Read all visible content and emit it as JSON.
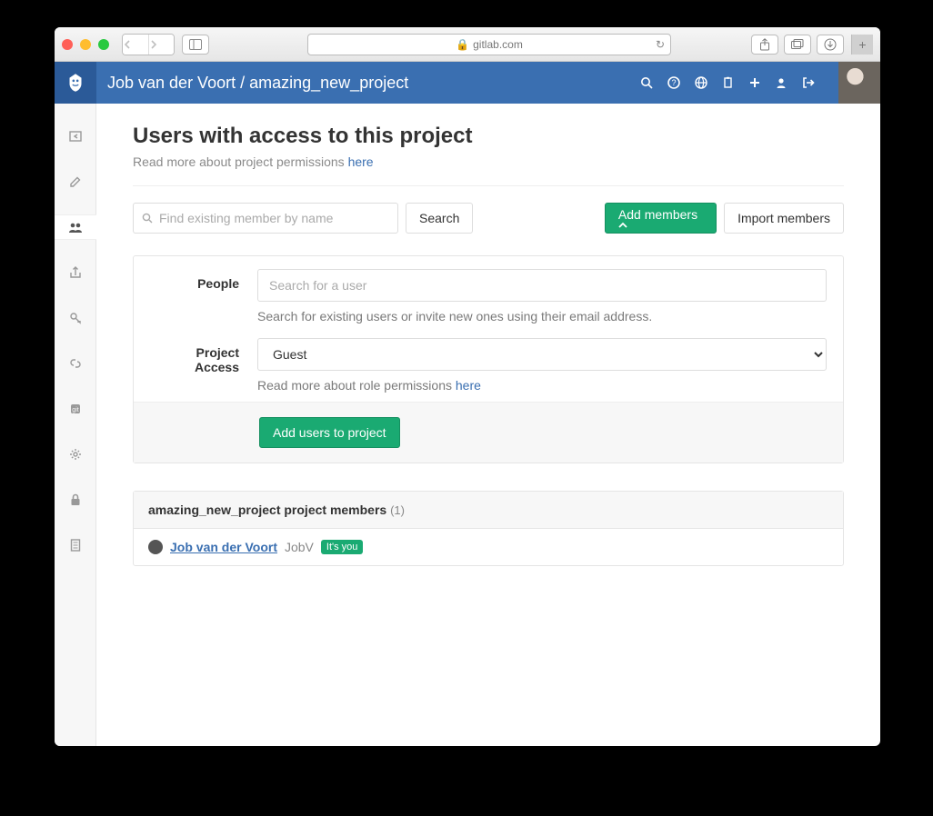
{
  "browser": {
    "url_host": "gitlab.com"
  },
  "breadcrumb": {
    "owner": "Job van der Voort",
    "sep": " / ",
    "project": "amazing_new_project"
  },
  "page": {
    "title": "Users with access to this project",
    "perm_text": "Read more about project permissions ",
    "perm_link": "here"
  },
  "action": {
    "find_placeholder": "Find existing member by name",
    "search_label": "Search",
    "add_members_label": "Add members",
    "import_label": "Import members"
  },
  "form": {
    "people_label": "People",
    "people_placeholder": "Search for a user",
    "people_help": "Search for existing users or invite new ones using their email address.",
    "access_label": "Project Access",
    "access_value": "Guest",
    "access_help_pre": "Read more about role permissions ",
    "access_help_link": "here",
    "submit_label": "Add users to project"
  },
  "members": {
    "heading_prefix": "amazing_new_project project members",
    "count_label": "(1)",
    "row": {
      "name": "Job van der Voort",
      "username": "JobV",
      "you_badge": "It's you"
    }
  }
}
